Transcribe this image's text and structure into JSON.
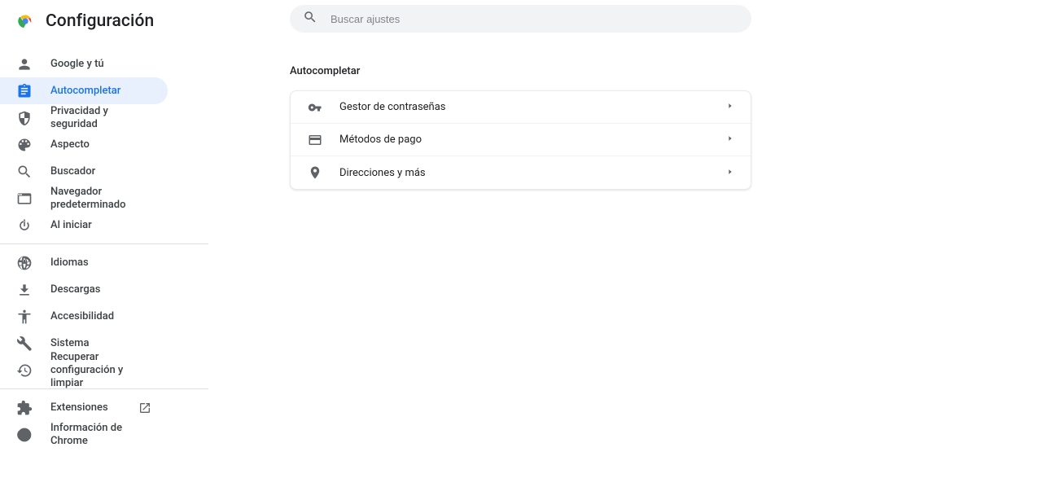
{
  "app": {
    "title": "Configuración"
  },
  "search": {
    "placeholder": "Buscar ajustes"
  },
  "sidebar": {
    "groups": [
      {
        "items": [
          {
            "label": "Google y tú",
            "icon": "person",
            "selected": false
          },
          {
            "label": "Autocompletar",
            "icon": "assignment",
            "selected": true
          },
          {
            "label": "Privacidad y seguridad",
            "icon": "shield",
            "selected": false
          },
          {
            "label": "Aspecto",
            "icon": "palette",
            "selected": false
          },
          {
            "label": "Buscador",
            "icon": "search",
            "selected": false
          },
          {
            "label": "Navegador predeterminado",
            "icon": "browser",
            "selected": false
          },
          {
            "label": "Al iniciar",
            "icon": "power",
            "selected": false
          }
        ]
      },
      {
        "items": [
          {
            "label": "Idiomas",
            "icon": "globe",
            "selected": false
          },
          {
            "label": "Descargas",
            "icon": "download",
            "selected": false
          },
          {
            "label": "Accesibilidad",
            "icon": "accessibility",
            "selected": false
          },
          {
            "label": "Sistema",
            "icon": "wrench",
            "selected": false
          },
          {
            "label": "Recuperar configuración y limpiar",
            "icon": "restore",
            "selected": false
          }
        ]
      },
      {
        "items": [
          {
            "label": "Extensiones",
            "icon": "extension",
            "selected": false,
            "external": true
          },
          {
            "label": "Información de Chrome",
            "icon": "chrome",
            "selected": false
          }
        ]
      }
    ]
  },
  "main": {
    "section_title": "Autocompletar",
    "rows": [
      {
        "label": "Gestor de contraseñas",
        "icon": "key"
      },
      {
        "label": "Métodos de pago",
        "icon": "credit-card"
      },
      {
        "label": "Direcciones y más",
        "icon": "place"
      }
    ]
  }
}
